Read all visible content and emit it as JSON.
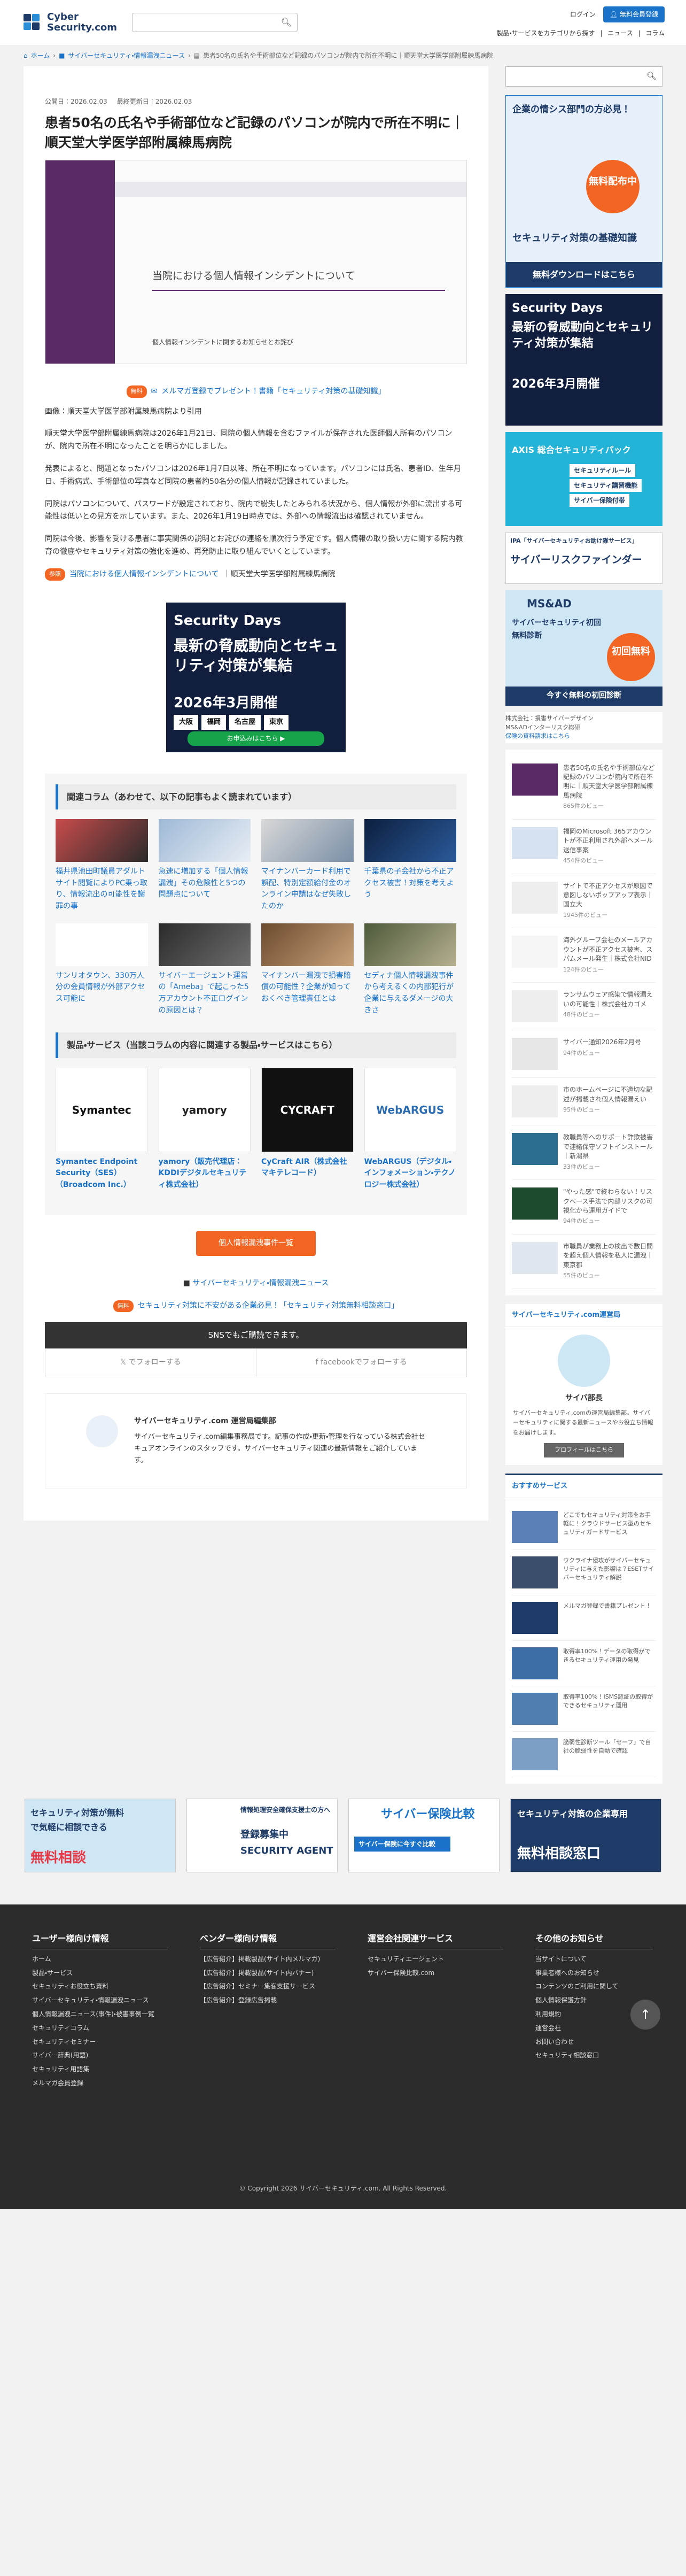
{
  "header": {
    "logo_line1": "Cyber",
    "logo_line2": "Security.com",
    "search_placeholder": "",
    "login": "ログイン",
    "free_register": "無料会員登録",
    "category_search": "製品・サービスをカテゴリから探す",
    "news": "ニュース",
    "column": "コラム"
  },
  "breadcrumb": {
    "home": "ホーム",
    "cat": "サイバーセキュリティ・情報漏洩ニュース",
    "current": "患者50名の氏名や手術部位など記録のパソコンが院内で所在不明に｜順天堂大学医学部附属練馬病院"
  },
  "article": {
    "published": "公開日：2026.02.03",
    "updated": "最終更新日：2026.02.03",
    "title": "患者50名の氏名や手術部位など記録のパソコンが院内で所在不明に｜順天堂大学医学部附属練馬病院",
    "hero_heading": "当院における個人情報インシデントについて",
    "hero_sub": "個人情報インシデントに関するお知らせとお詫び",
    "promo_text": "メルマガ登録でプレゼント！書籍「セキュリティ対策の基礎知識」",
    "promo_tag": "無料",
    "source": "画像：順天堂大学医学部附属練馬病院より引用",
    "paragraphs": [
      "順天堂大学医学部附属練馬病院は2026年1月21日、同院の個人情報を含むファイルが保存された医師個人所有のパソコンが、院内で所在不明になったことを明らかにしました。",
      "発表によると、問題となったパソコンは2026年1月7日以降、所在不明になっています。パソコンには氏名、患者ID、生年月日、手術病式、手術部位の写真など同院の患者約50名分の個人情報が記録されていました。",
      "同院はパソコンについて、パスワードが設定されており、院内で紛失したとみられる状況から、個人情報が外部に流出する可能性は低いとの見方を示しています。また、2026年1月19日時点では、外部への情報流出は確認されていません。",
      "同院は今後、影響を受ける患者に事実関係の説明とお詫びの連絡を順次行う予定です。個人情報の取り扱い方に関する院内教育の徹底やセキュリティ対策の強化を進め、再発防止に取り組んでいくとしています。"
    ],
    "related_tag": "参照",
    "related_link": "当院における個人情報インシデントについて",
    "related_suffix": "｜順天堂大学医学部附属練馬病院"
  },
  "ad_main": {
    "brand": "Security Days",
    "headline": "最新の脅威動向とセキュリティ対策が集結",
    "date": "2026年3月開催",
    "cities": [
      "大阪",
      "福岡",
      "名古屋",
      "東京"
    ],
    "cta": "お申込みはこちら ▶"
  },
  "related_columns": {
    "heading": "関連コラム（あわせて、以下の記事もよく読まれています）",
    "items": [
      "福井県池田町議員アダルトサイト閲覧によりPC乗っ取り、情報流出の可能性を謝罪の事",
      "急速に増加する「個人情報漏洩」その危険性と5つの問題点について",
      "マイナンバーカード利用で誤配、特別定額給付金のオンライン申請はなぜ失敗したのか",
      "千葉県の子会社から不正アクセス被害！対策を考えよう",
      "サンリオタウン、330万人分の会員情報が外部アクセス可能に",
      "サイバーエージェント運営の「Ameba」で起こった5万アカウント不正ログインの原因とは？",
      "マイナンバー漏洩で損害賠償の可能性？企業が知っておくべき管理責任とは",
      "セディナ個人情報漏洩事件から考えるくの内部犯行が企業に与えるダメージの大きさ"
    ]
  },
  "products": {
    "heading": "製品・サービス（当該コラムの内容に関連する製品・サービスはこちら）",
    "items": [
      {
        "logo": "Symantec",
        "name": "Symantec Endpoint Security（SES）（Broadcom Inc.）"
      },
      {
        "logo": "yamory",
        "name": "yamory（販売代理店：KDDIデジタルセキュリティ株式会社）"
      },
      {
        "logo": "CYCRAFT",
        "name": "CyCraft AIR（株式会社マキテレコード）"
      },
      {
        "logo": "WebARGUS",
        "name": "WebARGUS（デジタル・インフォメーション・テクノロジー株式会社）"
      }
    ],
    "button": "個人情報漏洩事件一覧"
  },
  "category_link": "サイバーセキュリティ・情報漏洩ニュース",
  "consult": {
    "tag": "無料",
    "text": "セキュリティ対策に不安がある企業必見！「セキュリティ対策無料相談窓口」"
  },
  "sns": {
    "heading": "SNSでもご購読できます。",
    "x": "でフォローする",
    "fb": "facebookでフォローする"
  },
  "author": {
    "name": "サイバーセキュリティ.com 運営局編集部",
    "desc": "サイバーセキュリティ.com編集事務局です。記事の作成・更新・管理を行なっている株式会社セキュアオンラインのスタッフです。サイバーセキュリティ関連の最新情報をご紹介しています。"
  },
  "sidebar": {
    "ad1_title": "企業の情シス部門の方必見！",
    "ad1_sub": "セキュリティ対策の基礎知識",
    "ad1_badge": "無料配布中",
    "ad1_cta": "無料ダウンロードはこちら",
    "ad2_brand": "Security Days",
    "ad2_head": "最新の脅威動向とセキュリティ対策が集結",
    "ad2_date": "2026年3月開催",
    "ad3_title": "AXIS 総合セキュリティパック",
    "ad3_items": [
      "セキュリティルール",
      "セキュリティ講習機能",
      "サイバー保険付帯"
    ],
    "ad4_title": "IPA「サイバーセキュリティお助け隊サービス」",
    "ad4_sub": "サイバーリスクファインダー",
    "ad5_brand": "MS&AD",
    "ad5_head": "サイバーセキュリティ初回無料診断",
    "ad5_badge": "初回無料",
    "ad5_cta": "今すぐ無料の初回診断",
    "ad5_note1": "株式会社：損害サイバーデザイン",
    "ad5_note2": "MS&ADインターリスク総研",
    "ad5_note3": "保険の資料請求はこちら",
    "news": [
      {
        "title": "患者50名の氏名や手術部位など記録のパソコンが院内で所在不明に｜順天堂大学医学部附属練馬病院",
        "count": "865件のビュー"
      },
      {
        "title": "福岡のMicrosoft 365アカウントが不正利用され外部へメール送信事案",
        "count": "454件のビュー"
      },
      {
        "title": "サイトで不正アクセスが原因で意図しないポップアップ表示｜国立大",
        "count": "1945件のビュー"
      },
      {
        "title": "海外グループ会社のメールアカウントが不正アクセス被害、スパムメール発生｜株式会社NID",
        "count": "124件のビュー"
      },
      {
        "title": "ランサムウェア感染で情報漏えいの可能性｜株式会社カゴメ",
        "count": "48件のビュー"
      },
      {
        "title": "サイバー通知2026年2月号",
        "count": "94件のビュー"
      },
      {
        "title": "市のホームページに不適切な記述が掲載され個人情報漏えい",
        "count": "95件のビュー"
      },
      {
        "title": "教職員等へのサポート詐欺被害で連絡保守ソフトインストール｜新潟県",
        "count": "33件のビュー"
      },
      {
        "title": "\"やった感\"で終わらない！リスクベース手法で内部リスクの可視化から運用ガイドで",
        "count": "94件のビュー"
      },
      {
        "title": "市職員が業務上の検出で数日間を超え個人情報を私人に漏洩｜東京都",
        "count": "55件のビュー"
      }
    ],
    "profile_title": "サイバーセキュリティ.com運営局",
    "profile_name": "サイバ部長",
    "profile_desc": "サイバーセキュリティ.comの運営局編集部。サイバーセキュリティに関する最新ニュースやお役立ち情報をお届けします。",
    "profile_btn": "プロフィールはこちら",
    "rec_title": "おすすめサービス",
    "rec": [
      "どこでもセキュリティ対策をお手軽に！クラウドサービス型のセキュリティガードサービス",
      "ウクライナ侵攻がサイバーセキュリティに与えた影響は？ESETサイバーセキュリティ解説",
      "メルマガ登録で書籍プレゼント！",
      "取得率100%！データの取得ができるセキュリティ運用の発見",
      "取得率100%！ISMS認証の取得ができるセキュリティ運用",
      "脆弱性診断ツール「セーフ」で自社の脆弱性を自動で確認"
    ],
    "rec_badge": "メルマガ登録で書籍プレゼント"
  },
  "bottom_banners": [
    {
      "a": "セキュリティ対策が無料で気軽に相談できる",
      "b": "無料相談"
    },
    {
      "a": "情報処理安全確保支援士の方へ",
      "b": "登録募集中 SECURITY AGENT"
    },
    {
      "a": "サイバー保険比較",
      "b": "サイバー保険に今すぐ比較"
    },
    {
      "a": "セキュリティ対策の企業専用",
      "b": "無料相談窓口"
    }
  ],
  "footer": {
    "cols": [
      {
        "h": "ユーザー様向け情報",
        "items": [
          "ホーム",
          "製品・サービス",
          "セキュリティお役立ち資料",
          "サイバーセキュリティ・情報漏洩ニュース",
          "個人情報漏洩ニュース(事件)・被害事例一覧",
          "セキュリティコラム",
          "セキュリティセミナー",
          "サイバー辞典(用語)",
          "セキュリティ用語集",
          "メルマガ会員登録"
        ]
      },
      {
        "h": "ベンダー様向け情報",
        "items": [
          "【広告紹介】掲載製品(サイト内メルマガ)",
          "【広告紹介】掲載製品(サイト内バナー)",
          "【広告紹介】セミナー集客支援サービス",
          "【広告紹介】登録広告掲載"
        ]
      },
      {
        "h": "運営会社関連サービス",
        "items": [
          "セキュリティエージェント",
          "サイバー保険比較.com"
        ]
      },
      {
        "h": "その他のお知らせ",
        "items": [
          "当サイトについて",
          "事業者様へのお知らせ",
          "コンテンツのご利用に関して",
          "個人情報保護方針",
          "利用規約",
          "運営会社",
          "お問い合わせ",
          "セキュリティ相談窓口"
        ]
      }
    ],
    "copyright": "© Copyright 2026 サイバーセキュリティ.com. All Rights Reserved."
  },
  "colors": {
    "accent": "#1a73c8",
    "orange": "#f26522",
    "navy": "#1d3b66",
    "purple": "#5a2a67"
  }
}
